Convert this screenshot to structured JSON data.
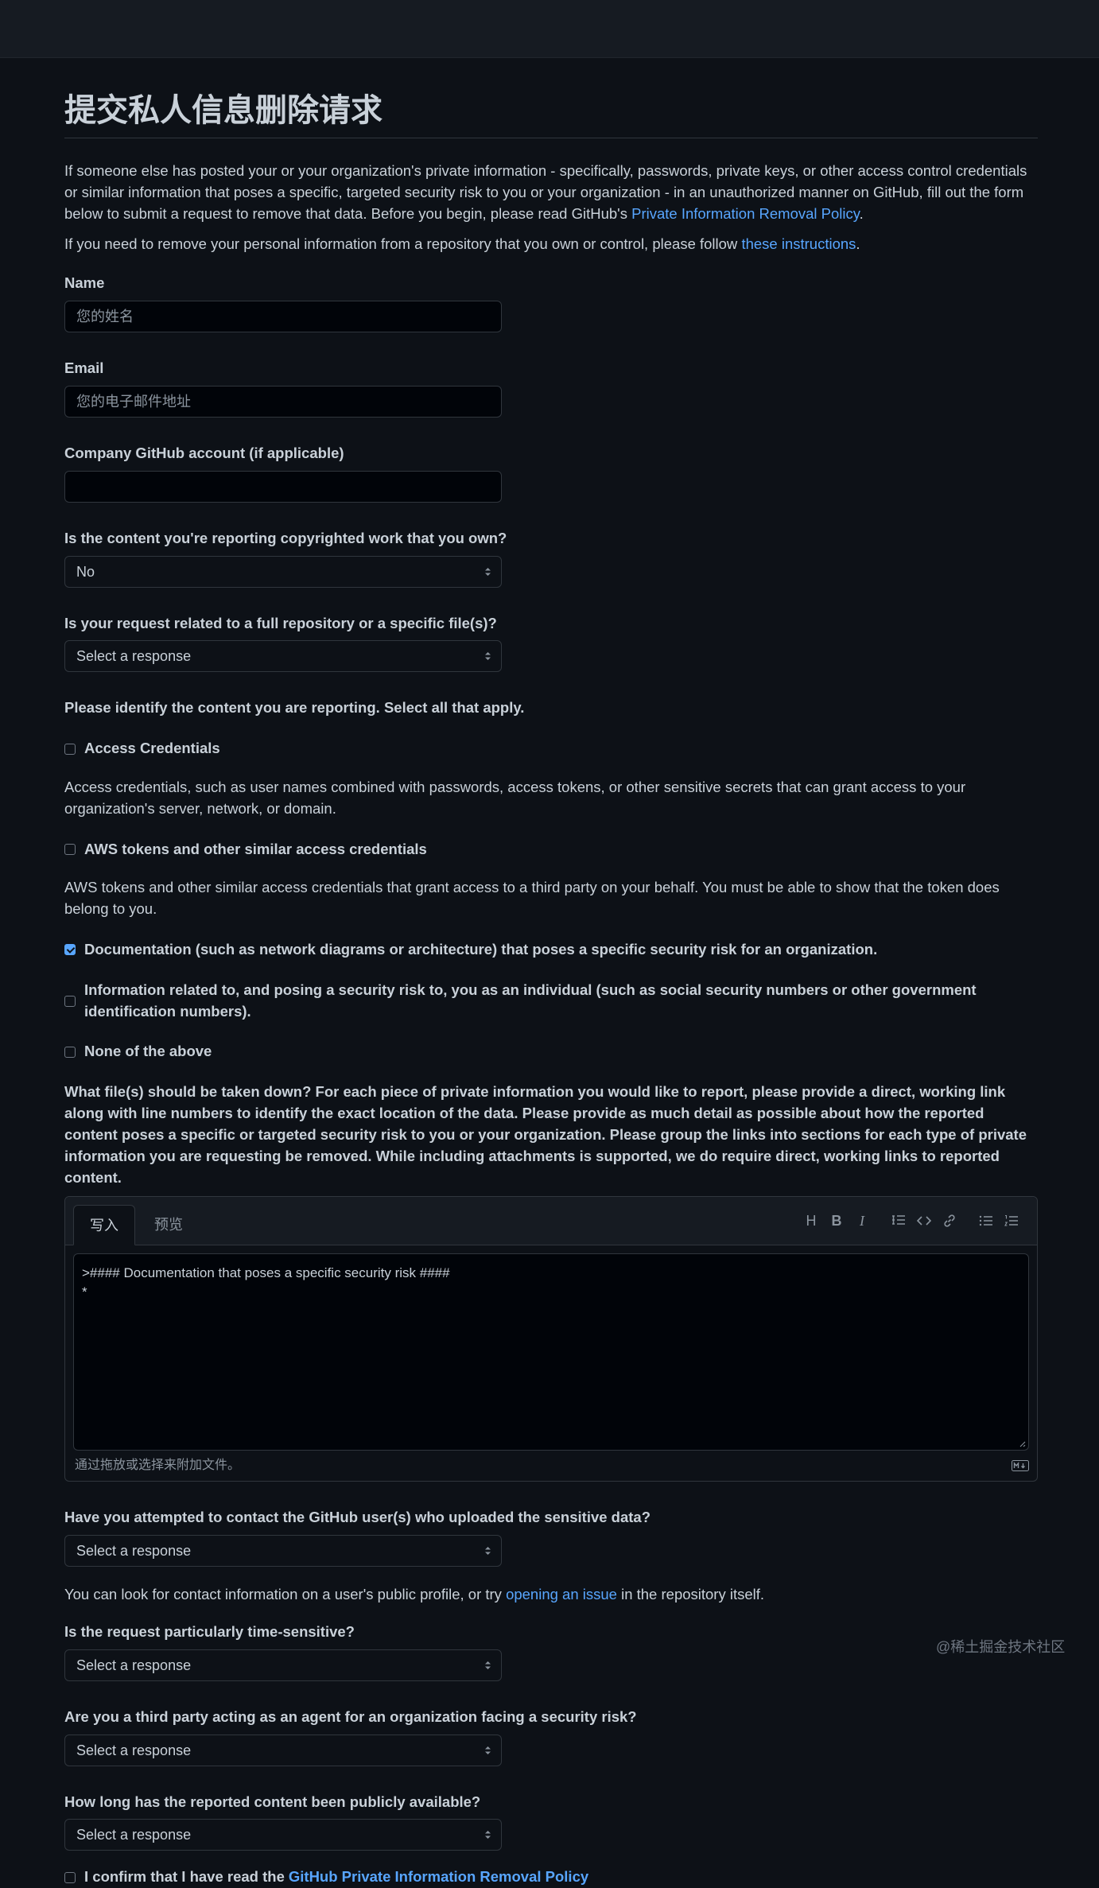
{
  "page": {
    "title": "提交私人信息删除请求",
    "intro": {
      "text": "If someone else has posted your or your organization's private information - specifically, passwords, private keys, or other access control credentials or similar information that poses a specific, targeted security risk to you or your organization - in an unauthorized manner on GitHub, fill out the form below to submit a request to remove that data. Before you begin, please read GitHub's ",
      "link": "Private Information Removal Policy",
      "after": "."
    },
    "intro2": {
      "text": "If you need to remove your personal information from a repository that you own or control, please follow ",
      "link": "these instructions",
      "after": "."
    }
  },
  "form": {
    "name": {
      "label": "Name",
      "placeholder": "您的姓名"
    },
    "email": {
      "label": "Email",
      "placeholder": "您的电子邮件地址"
    },
    "company": {
      "label": "Company GitHub account (if applicable)",
      "value": ""
    },
    "copyright": {
      "label": "Is the content you're reporting copyrighted work that you own?",
      "value": "No"
    },
    "scope": {
      "label": "Is your request related to a full repository or a specific file(s)?",
      "value": "Select a response"
    },
    "identify_label": "Please identify the content you are reporting. Select all that apply.",
    "options": [
      {
        "label": "Access Credentials",
        "checked": false,
        "desc": "Access credentials, such as user names combined with passwords, access tokens, or other sensitive secrets that can grant access to your organization's server, network, or domain."
      },
      {
        "label": "AWS tokens and other similar access credentials",
        "checked": false,
        "desc": "AWS tokens and other similar access credentials that grant access to a third party on your behalf. You must be able to show that the token does belong to you."
      },
      {
        "label": "Documentation (such as network diagrams or architecture) that poses a specific security risk for an organization.",
        "checked": true,
        "desc": ""
      },
      {
        "label": "Information related to, and posing a security risk to, you as an individual (such as social security numbers or other government identification numbers).",
        "checked": false,
        "desc": ""
      },
      {
        "label": "None of the above",
        "checked": false,
        "desc": ""
      }
    ],
    "files_label": "What file(s) should be taken down? For each piece of private information you would like to report, please provide a direct, working link along with line numbers to identify the exact location of the data. Please provide as much detail as possible about how the reported content poses a specific or targeted security risk to you or your organization. Please group the links into sections for each type of private information you are requesting be removed. While including attachments is supported, we do require direct, working links to reported content.",
    "editor": {
      "tab_write": "写入",
      "tab_preview": "预览",
      "content": ">#### Documentation that poses a specific security risk ####\n*",
      "footer": "通过拖放或选择来附加文件。"
    },
    "contacted": {
      "label": "Have you attempted to contact the GitHub user(s) who uploaded the sensitive data?",
      "value": "Select a response"
    },
    "contact_hint": {
      "text": "You can look for contact information on a user's public profile, or try ",
      "link": "opening an issue",
      "after": " in the repository itself."
    },
    "time_sensitive": {
      "label": "Is the request particularly time-sensitive?",
      "value": "Select a response"
    },
    "third_party": {
      "label": "Are you a third party acting as an agent for an organization facing a security risk?",
      "value": "Select a response"
    },
    "duration": {
      "label": "How long has the reported content been publicly available?",
      "value": "Select a response"
    },
    "confirm": {
      "text": "I confirm that I have read the ",
      "link": "GitHub Private Information Removal Policy",
      "checked": false
    }
  },
  "watermark": "@稀土掘金技术社区"
}
